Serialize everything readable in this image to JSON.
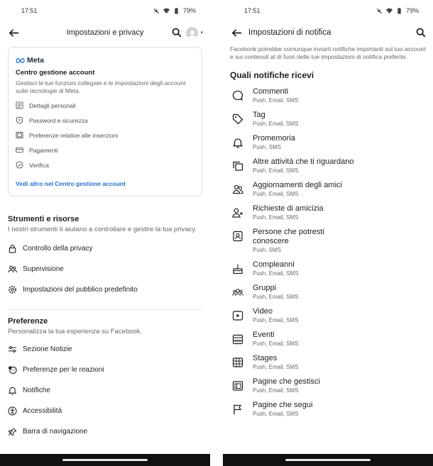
{
  "left": {
    "status": {
      "time": "17:51",
      "battery": "79%"
    },
    "header": {
      "title": "Impostazioni e privacy"
    },
    "account_card": {
      "brand": "Meta",
      "title": "Centro gestione account",
      "description": "Gestisci le tue funzioni collegate e le impostazioni degli account sulle tecnologie di Meta.",
      "items": [
        {
          "label": "Dettagli personali",
          "icon": "id-card-icon"
        },
        {
          "label": "Password e sicurezza",
          "icon": "shield-icon"
        },
        {
          "label": "Preferenze relative alle inserzioni",
          "icon": "ad-icon"
        },
        {
          "label": "Pagamenti",
          "icon": "credit-card-icon"
        },
        {
          "label": "Verifica",
          "icon": "verified-icon"
        }
      ],
      "link": "Vedi altro nel Centro gestione account"
    },
    "tools": {
      "title": "Strumenti e risorse",
      "description": "I nostri strumenti ti aiutano a controllare e gestire la tua privacy.",
      "items": [
        {
          "label": "Controllo della privacy",
          "icon": "lock-icon"
        },
        {
          "label": "Supervisione",
          "icon": "people-icon"
        },
        {
          "label": "Impostazioni del pubblico predefinito",
          "icon": "gear-icon"
        }
      ]
    },
    "preferences": {
      "title": "Preferenze",
      "description": "Personalizza la tua esperienza su Facebook.",
      "items": [
        {
          "label": "Sezione Notizie",
          "icon": "sliders-icon"
        },
        {
          "label": "Preferenze per le reazioni",
          "icon": "reaction-icon"
        },
        {
          "label": "Notifiche",
          "icon": "bell-icon"
        },
        {
          "label": "Accessibilità",
          "icon": "accessibility-icon"
        },
        {
          "label": "Barra di navigazione",
          "icon": "pin-icon"
        }
      ]
    }
  },
  "right": {
    "status": {
      "time": "17:51",
      "battery": "79%"
    },
    "header": {
      "title": "Impostazioni di notifica"
    },
    "intro": "Facebook potrebbe comunque inviarti notifiche importanti sul tuo account e sui contenuti al di fuori delle tue impostazioni di notifica preferite.",
    "section_title": "Quali notifiche ricevi",
    "items": [
      {
        "title": "Commenti",
        "sub": "Push, Email, SMS",
        "icon": "comment-icon"
      },
      {
        "title": "Tag",
        "sub": "Push, Email, SMS",
        "icon": "tag-icon"
      },
      {
        "title": "Promemoria",
        "sub": "Push, SMS",
        "icon": "bell-icon"
      },
      {
        "title": "Altre attività che ti riguardano",
        "sub": "Push, Email, SMS",
        "icon": "activity-icon"
      },
      {
        "title": "Aggiornamenti degli amici",
        "sub": "Push, Email, SMS",
        "icon": "friends-icon"
      },
      {
        "title": "Richieste di amicizia",
        "sub": "Push, Email, SMS",
        "icon": "add-friend-icon"
      },
      {
        "title": "Persone che potresti conoscere",
        "sub": "Push, SMS",
        "icon": "contact-card-icon"
      },
      {
        "title": "Compleanni",
        "sub": "Push, Email, SMS",
        "icon": "cake-icon"
      },
      {
        "title": "Gruppi",
        "sub": "Push, Email, SMS",
        "icon": "groups-icon"
      },
      {
        "title": "Video",
        "sub": "Push, Email, SMS",
        "icon": "video-icon"
      },
      {
        "title": "Eventi",
        "sub": "Push, Email, SMS",
        "icon": "calendar-icon"
      },
      {
        "title": "Stages",
        "sub": "Push, Email, SMS",
        "icon": "stages-icon"
      },
      {
        "title": "Pagine che gestisci",
        "sub": "Push, Email, SMS",
        "icon": "page-icon"
      },
      {
        "title": "Pagine che segui",
        "sub": "Push, Email, SMS",
        "icon": "flag-icon"
      }
    ]
  }
}
